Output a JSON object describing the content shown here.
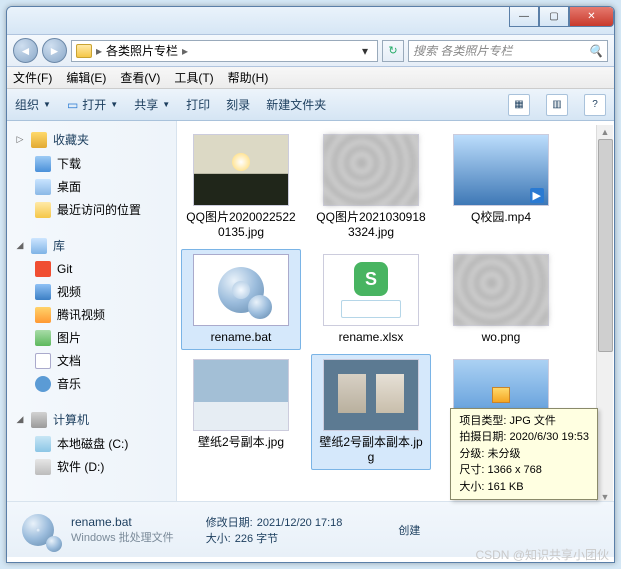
{
  "window": {
    "min_label": "—",
    "max_label": "▢",
    "close_label": "✕"
  },
  "address": {
    "path_segment": "各类照片专栏",
    "sep": "▸",
    "dropdown": "▾",
    "refresh": "↻"
  },
  "search": {
    "placeholder": "搜索 各类照片专栏",
    "icon": "🔍"
  },
  "menu": {
    "file": "文件(F)",
    "edit": "编辑(E)",
    "view": "查看(V)",
    "tools": "工具(T)",
    "help": "帮助(H)"
  },
  "toolbar": {
    "organize": "组织",
    "open": "打开",
    "share": "共享",
    "print": "打印",
    "burn": "刻录",
    "newfolder": "新建文件夹",
    "dd": "▼",
    "view_icon": "▦",
    "help_icon": "?"
  },
  "sidebar": {
    "favorites": "收藏夹",
    "downloads": "下载",
    "desktop": "桌面",
    "recent": "最近访问的位置",
    "libraries": "库",
    "git": "Git",
    "videos": "视频",
    "tencent": "腾讯视频",
    "pictures": "图片",
    "documents": "文档",
    "music": "音乐",
    "computer": "计算机",
    "drive_c": "本地磁盘 (C:)",
    "drive_d": "软件 (D:)"
  },
  "files": [
    {
      "name": "QQ图片20200225220135.jpg"
    },
    {
      "name": "QQ图片20210309183324.jpg"
    },
    {
      "name": "Q校园.mp4"
    },
    {
      "name": "rename.bat"
    },
    {
      "name": "rename.xlsx"
    },
    {
      "name": "wo.png"
    },
    {
      "name": "壁纸2号副本.jpg"
    },
    {
      "name": "壁纸2号副本副本.jpg"
    },
    {
      "name": ""
    }
  ],
  "details": {
    "filename": "rename.bat",
    "filetype": "Windows 批处理文件",
    "modified_label": "修改日期:",
    "modified_val": "2021/12/20 17:18",
    "size_label": "大小:",
    "size_val": "226 字节",
    "created_label": "创建"
  },
  "tooltip": {
    "l1_label": "项目类型:",
    "l1_val": "JPG 文件",
    "l2_label": "拍摄日期:",
    "l2_val": "2020/6/30 19:53",
    "l3_label": "分级:",
    "l3_val": "未分级",
    "l4_label": "尺寸:",
    "l4_val": "1366 x 768",
    "l5_label": "大小:",
    "l5_val": "161 KB"
  },
  "watermark": "CSDN @知识共享小团伙"
}
